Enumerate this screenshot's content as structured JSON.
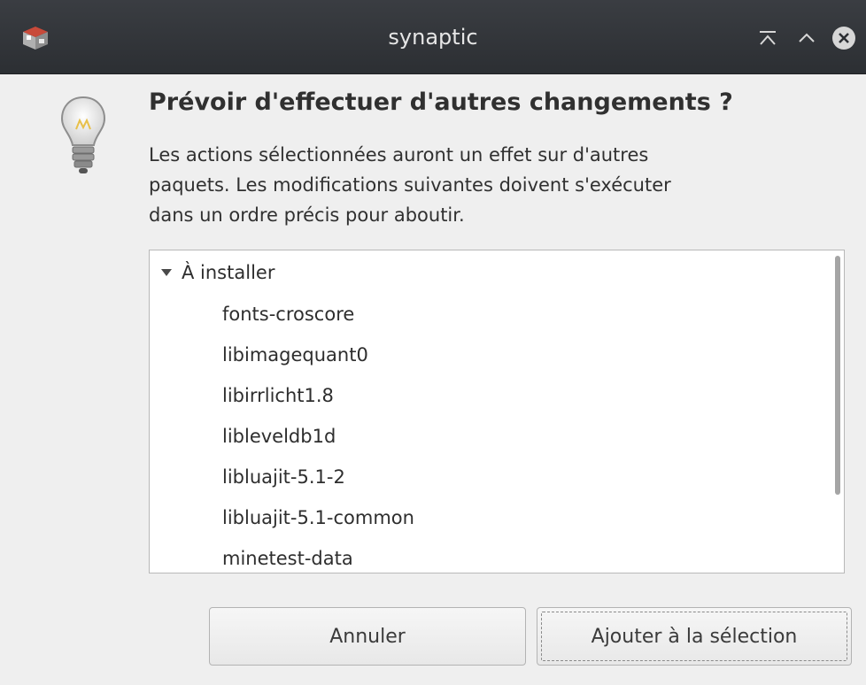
{
  "window": {
    "title": "synaptic",
    "icons": {
      "app": "synaptic-app-icon",
      "keep_above": "keep-above-icon",
      "maximize": "maximize-icon",
      "close": "close-icon"
    }
  },
  "dialog": {
    "icon": "lightbulb-icon",
    "heading": "Prévoir d'effectuer d'autres changements ?",
    "message_lines": [
      "Les actions sélectionnées auront un effet sur d'autres",
      "paquets. Les modifications suivantes doivent s'exécuter",
      "dans un ordre précis pour aboutir."
    ],
    "tree": {
      "group_label": "À installer",
      "expanded": true,
      "items": [
        "fonts-croscore",
        "libimagequant0",
        "libirrlicht1.8",
        "libleveldb1d",
        "libluajit-5.1-2",
        "libluajit-5.1-common",
        "minetest-data"
      ]
    },
    "buttons": {
      "cancel": "Annuler",
      "add": "Ajouter à la sélection"
    }
  },
  "colors": {
    "titlebar": "#2c2f33",
    "title_text": "#e6e6e6",
    "background": "#efefef",
    "list_background": "#ffffff",
    "close_button": "#d7d7d7"
  }
}
